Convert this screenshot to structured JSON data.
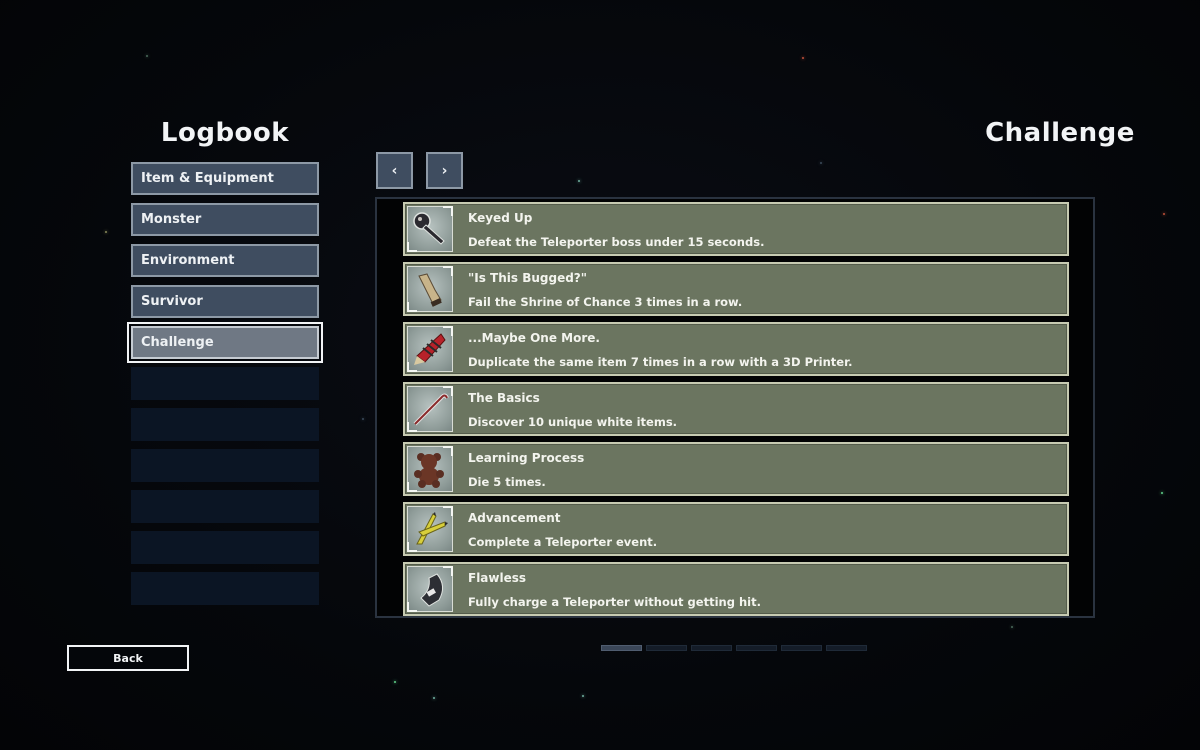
{
  "left_title": "Logbook",
  "right_title": "Challenge",
  "nav": {
    "items": [
      {
        "label": "Item & Equipment",
        "selected": false
      },
      {
        "label": "Monster",
        "selected": false
      },
      {
        "label": "Environment",
        "selected": false
      },
      {
        "label": "Survivor",
        "selected": false
      },
      {
        "label": "Challenge",
        "selected": true
      }
    ],
    "empty_slots": 6
  },
  "paging": {
    "prev_label": "‹",
    "next_label": "›",
    "page_count": 6,
    "current_page": 1
  },
  "challenges": [
    {
      "name": "Keyed Up",
      "description": "Defeat the Teleporter boss under 15 seconds.",
      "icon": "key-icon"
    },
    {
      "name": "\"Is This Bugged?\"",
      "description": "Fail the Shrine of Chance 3 times in a row.",
      "icon": "bandage-roll-icon"
    },
    {
      "name": "...Maybe One More.",
      "description": "Duplicate the same item 7 times in a row with a 3D Printer.",
      "icon": "firework-icon"
    },
    {
      "name": "The Basics",
      "description": "Discover 10 unique white items.",
      "icon": "crowbar-icon"
    },
    {
      "name": "Learning Process",
      "description": "Die 5 times.",
      "icon": "teddy-bear-icon"
    },
    {
      "name": "Advancement",
      "description": "Complete a Teleporter event.",
      "icon": "crossed-horns-icon"
    },
    {
      "name": "Flawless",
      "description": "Fully charge a Teleporter without getting hit.",
      "icon": "armor-plate-icon"
    }
  ],
  "back_label": "Back",
  "colors": {
    "background": "#05070b",
    "nav_button": "#3f4d60",
    "nav_selected": "#6f7884",
    "entry_background": "#6b7560",
    "entry_border": "#c7cbb2"
  }
}
